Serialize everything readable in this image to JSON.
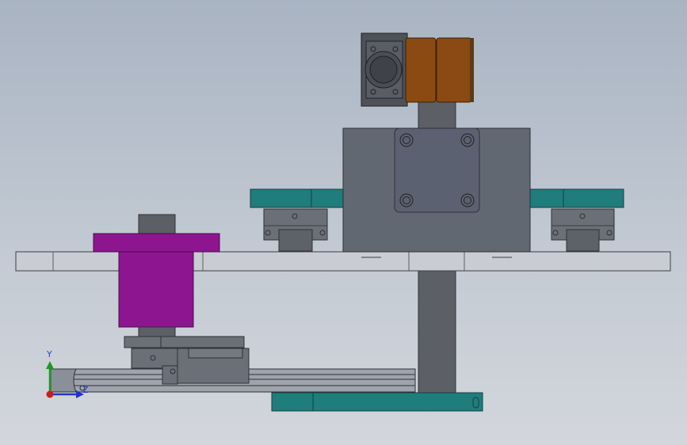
{
  "colors": {
    "plate": "#c9ccd3",
    "plate_edge": "#3c3f46",
    "carriage": "#6b6f78",
    "block": "#626872",
    "shaft": "#5c5f66",
    "rail_teal": "#1f7d7c",
    "purple": "#8e1590",
    "copper": "#8a4a12",
    "motor_dark": "#4e5157",
    "rail_gray": "#9ea4ad"
  },
  "icons": {
    "triad": "coordinate-triad-icon"
  },
  "triad": {
    "y_label": "Y",
    "z_label": "Z"
  }
}
